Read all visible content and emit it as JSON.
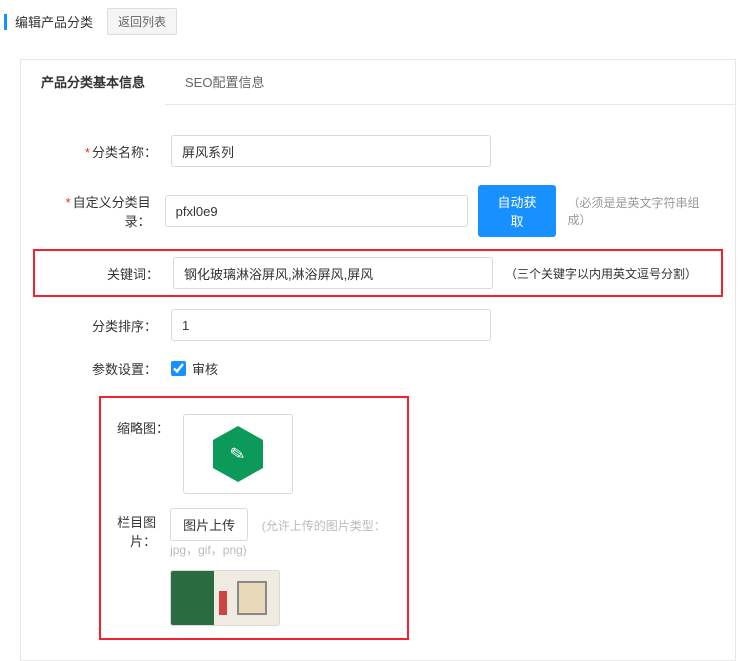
{
  "header": {
    "title": "编辑产品分类",
    "back_button": "返回列表"
  },
  "tabs": {
    "basic": "产品分类基本信息",
    "seo": "SEO配置信息"
  },
  "form": {
    "category_name": {
      "label": "分类名称：",
      "value": "屏风系列"
    },
    "custom_dir": {
      "label": "自定义分类目录：",
      "value": "pfxl0e9",
      "auto_button": "自动获取",
      "hint": "（必须是是英文字符串组成）"
    },
    "keywords": {
      "label": "关键词：",
      "value": "钢化玻璃淋浴屏风,淋浴屏风,屏风",
      "hint": "（三个关键字以内用英文逗号分割）"
    },
    "sort": {
      "label": "分类排序：",
      "value": "1"
    },
    "params": {
      "label": "参数设置：",
      "checkbox_label": "审核"
    },
    "thumbnail": {
      "label": "缩略图："
    },
    "column_image": {
      "label": "栏目图片：",
      "upload_button": "图片上传",
      "hint": "(允许上传的图片类型：jpg，gif，png)"
    }
  }
}
